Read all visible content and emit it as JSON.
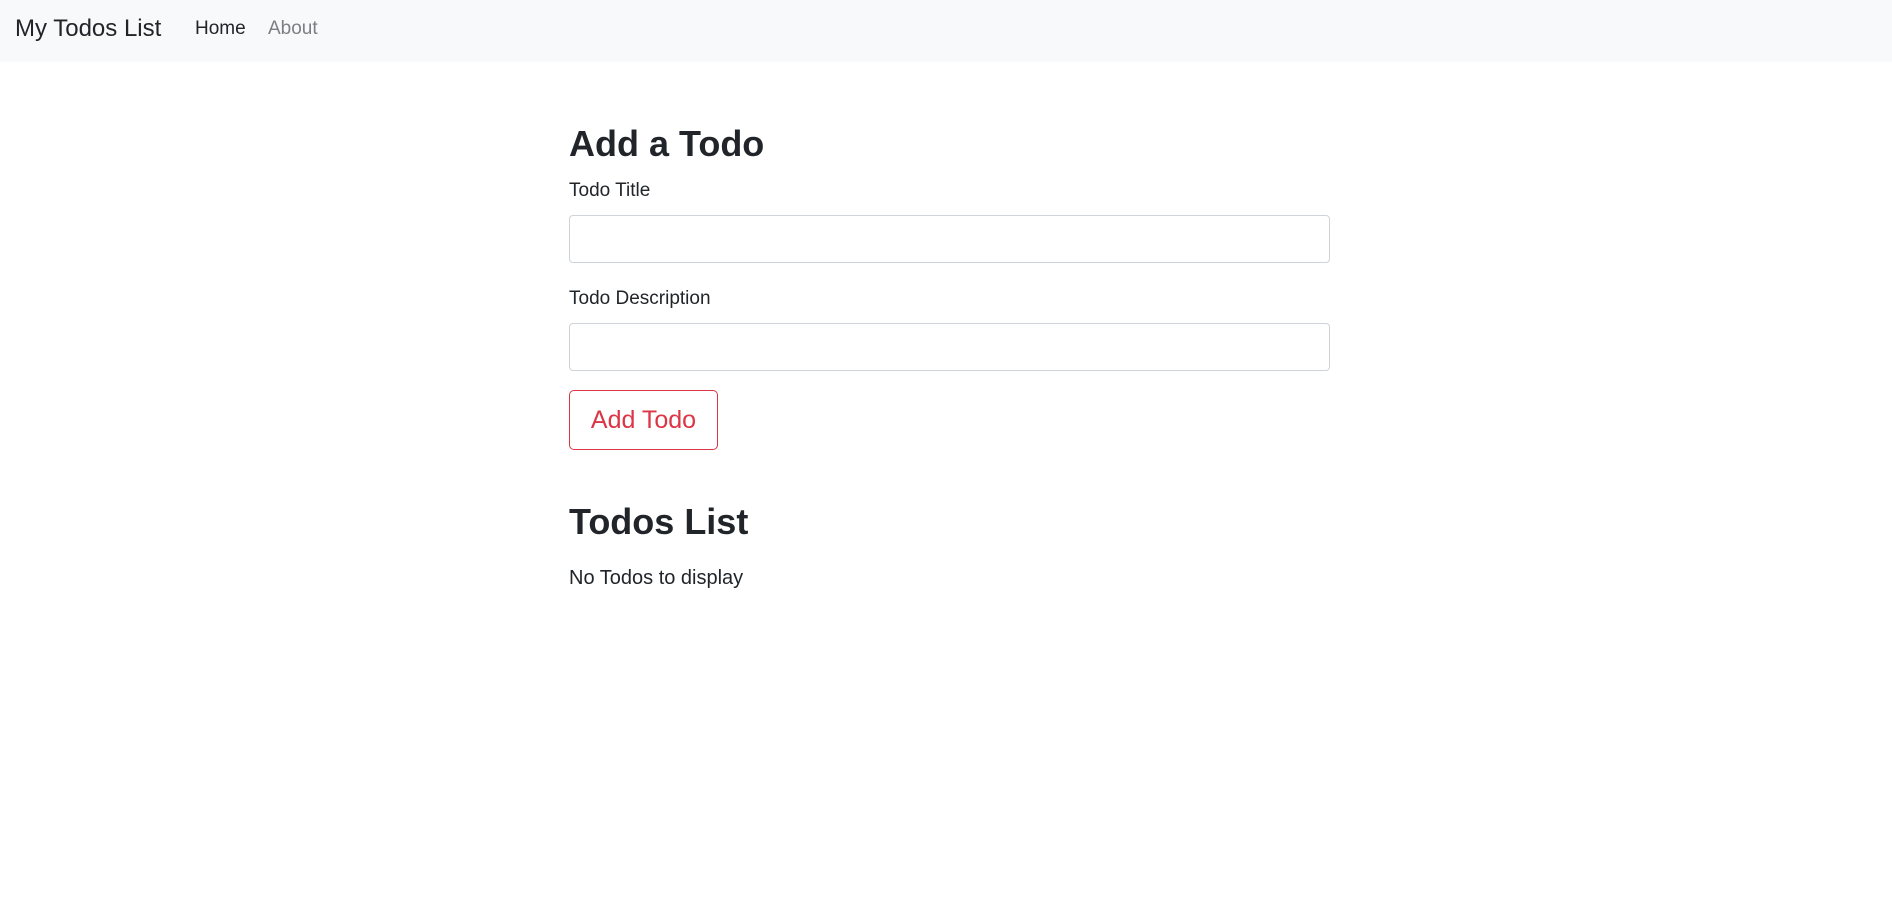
{
  "navbar": {
    "brand": "My Todos List",
    "links": [
      {
        "label": "Home",
        "active": true
      },
      {
        "label": "About",
        "active": false
      }
    ]
  },
  "form": {
    "heading": "Add a Todo",
    "title_label": "Todo Title",
    "title_value": "",
    "description_label": "Todo Description",
    "description_value": "",
    "submit_label": "Add Todo"
  },
  "list": {
    "heading": "Todos List",
    "empty_message": "No Todos to display"
  },
  "colors": {
    "navbar_bg": "#f8f9fa",
    "accent_danger": "#dc3545",
    "muted_link": "#7b7f84",
    "text": "#212529"
  }
}
